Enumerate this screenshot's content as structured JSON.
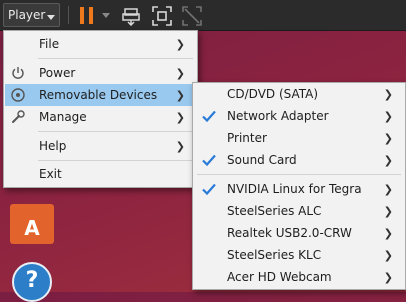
{
  "toolbar": {
    "player_label": "Player"
  },
  "player_menu": {
    "items": [
      {
        "label": "File"
      },
      {
        "label": "Power"
      },
      {
        "label": "Removable Devices"
      },
      {
        "label": "Manage"
      },
      {
        "label": "Help"
      },
      {
        "label": "Exit"
      }
    ]
  },
  "removable_devices": {
    "items": [
      {
        "label": "CD/DVD (SATA)",
        "checked": false
      },
      {
        "label": "Network Adapter",
        "checked": true
      },
      {
        "label": "Printer",
        "checked": false
      },
      {
        "label": "Sound Card",
        "checked": true
      },
      {
        "label": "NVIDIA Linux for Tegra",
        "checked": true
      },
      {
        "label": "SteelSeries ALC",
        "checked": false
      },
      {
        "label": "Realtek USB2.0-CRW",
        "checked": false
      },
      {
        "label": "SteelSeries KLC",
        "checked": false
      },
      {
        "label": "Acer HD Webcam",
        "checked": false
      }
    ]
  },
  "colors": {
    "menu_background": "#f2f2f2",
    "highlight": "#99c9ef",
    "check_mark": "#2a7ad8",
    "pause_accent": "#ef7a1d",
    "toolbar_background": "#2b2b2b"
  }
}
